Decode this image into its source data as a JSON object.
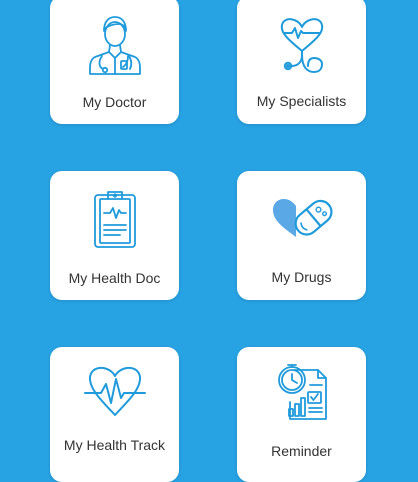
{
  "colors": {
    "background": "#27a2e3",
    "card": "#ffffff",
    "icon_accent": "#1f9bdc",
    "heart_fill": "#5aa9e6",
    "label_text": "#333333"
  },
  "tiles": [
    {
      "label": "My Doctor",
      "icon": "doctor-icon"
    },
    {
      "label": "My Specialists",
      "icon": "stethoscope-heart-icon"
    },
    {
      "label": "My Health Doc",
      "icon": "clipboard-pulse-icon"
    },
    {
      "label": "My Drugs",
      "icon": "heart-pill-icon"
    },
    {
      "label": "My Health Track",
      "icon": "heart-pulse-icon"
    },
    {
      "label": "Reminder",
      "icon": "clock-report-icon"
    }
  ]
}
